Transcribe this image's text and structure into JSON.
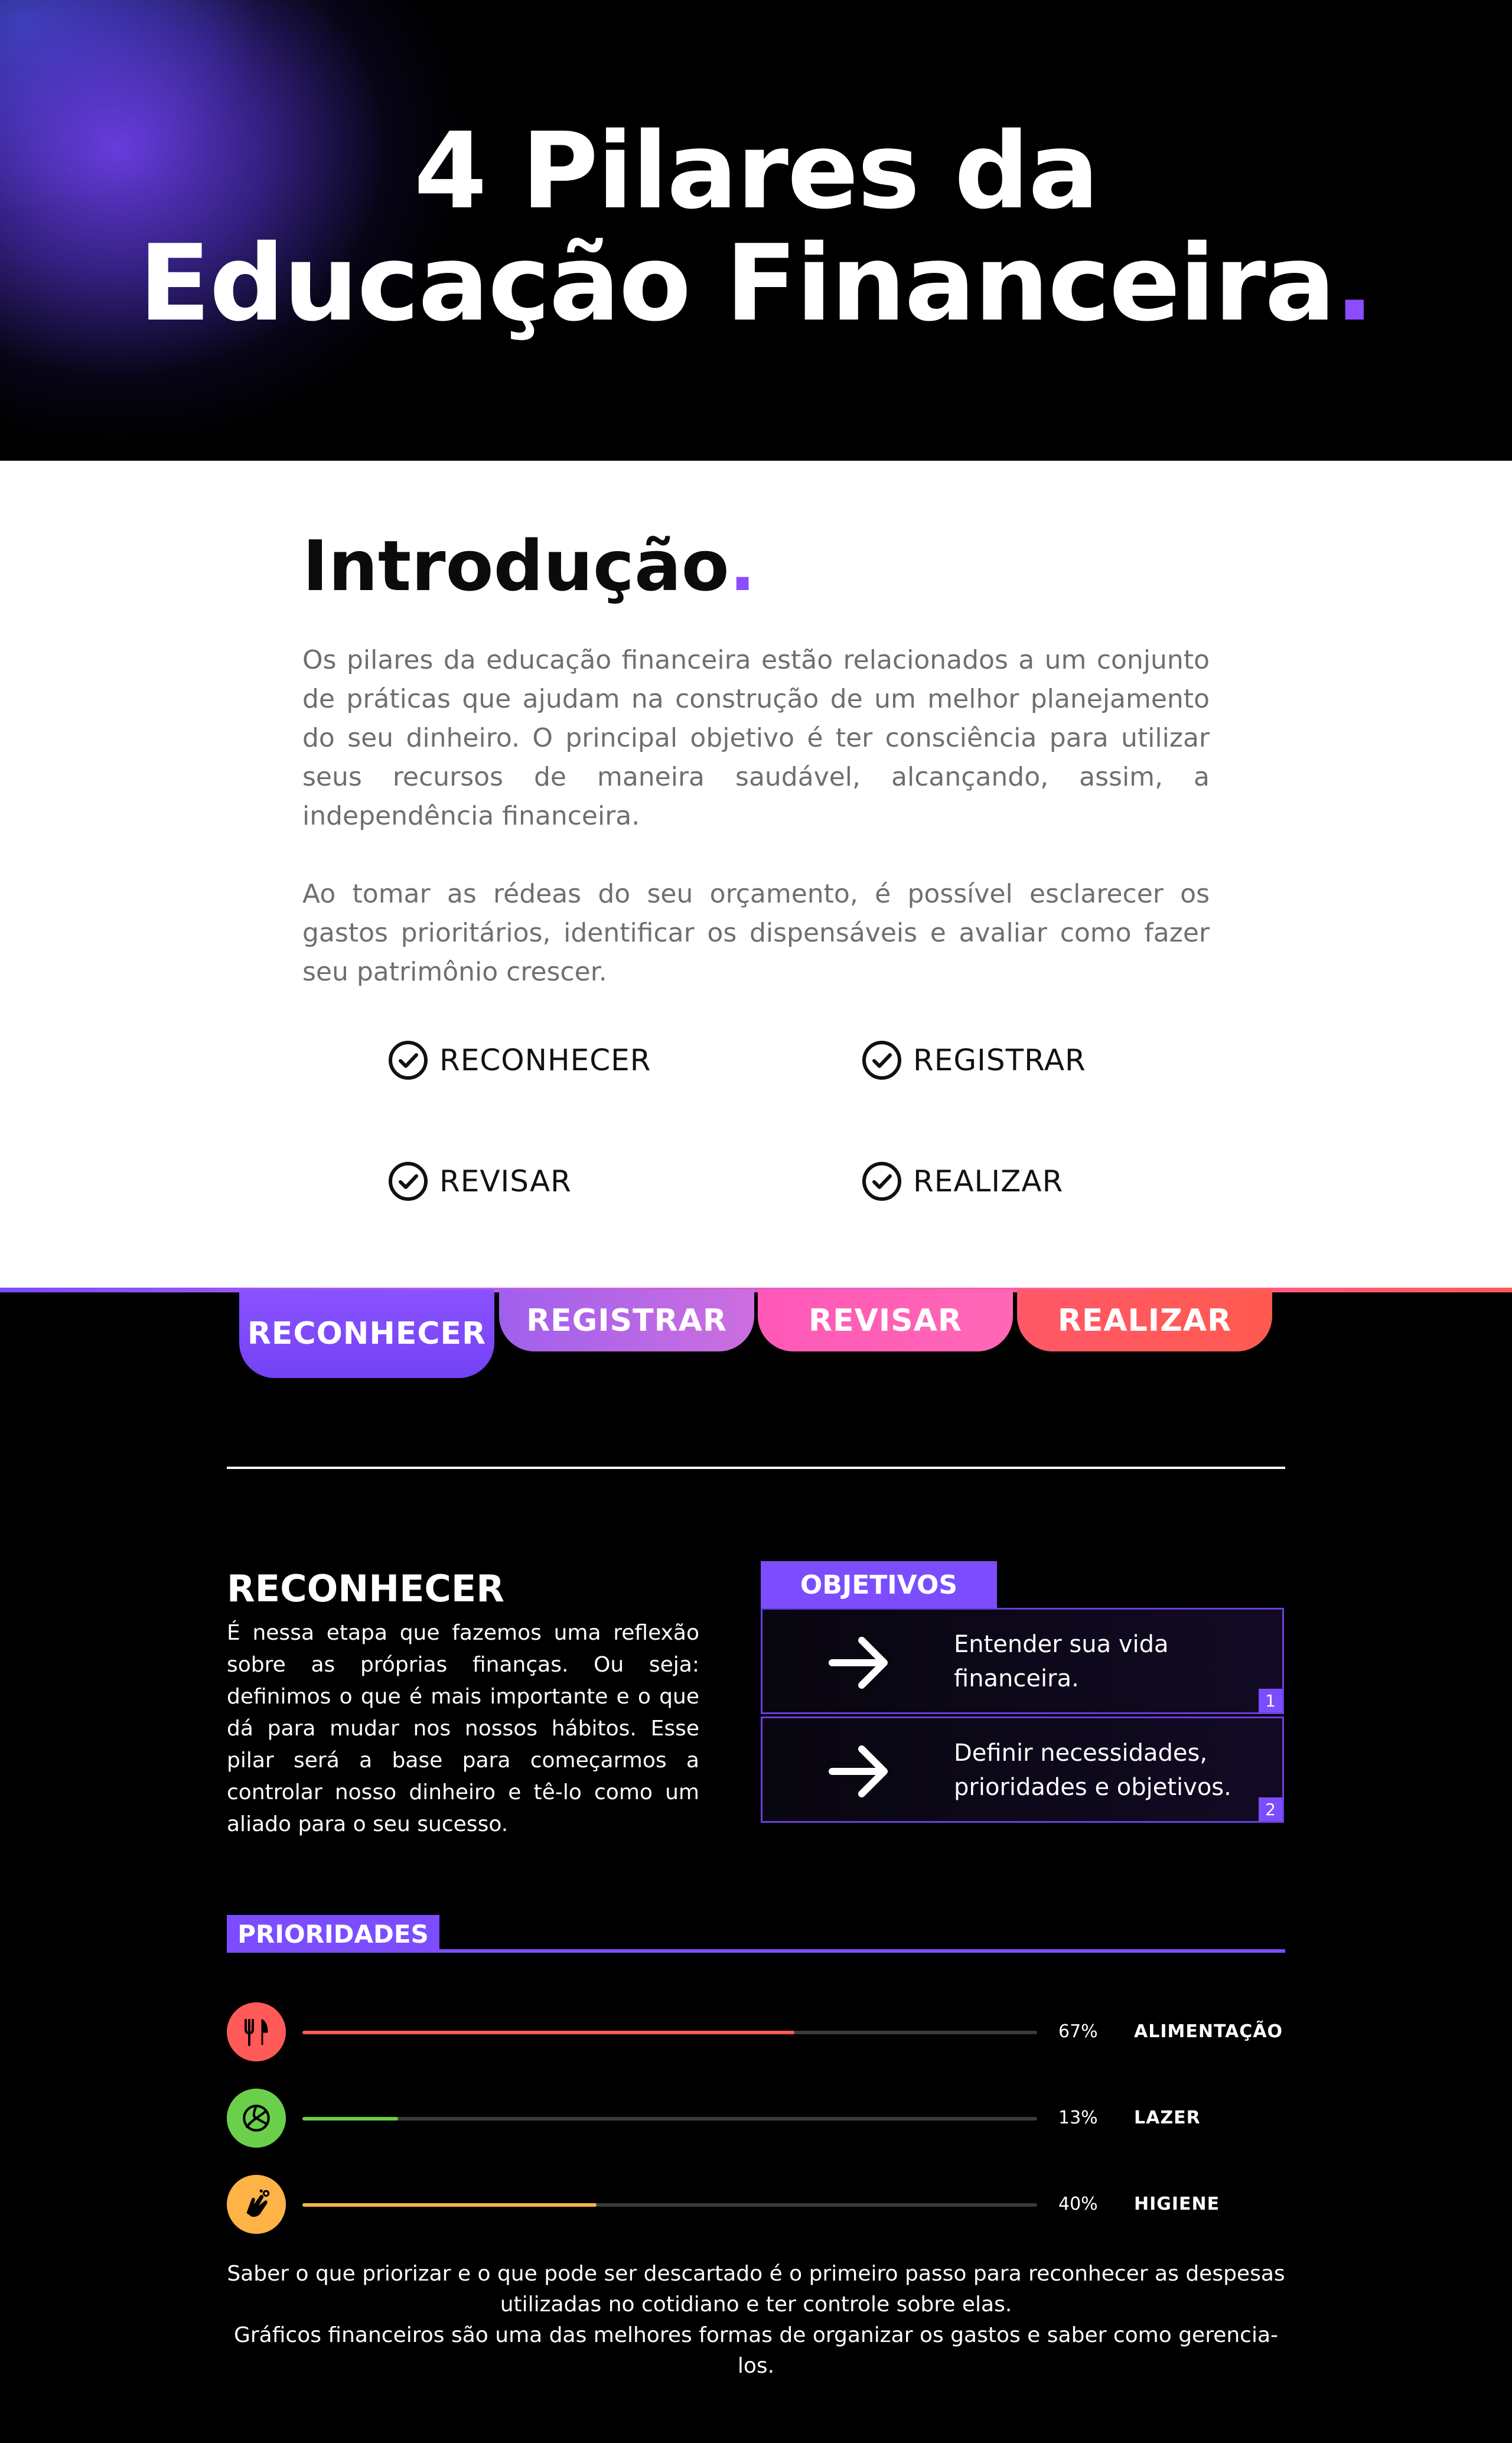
{
  "hero": {
    "title_line1": "4 Pilares da",
    "title_line2": "Educação Financeira",
    "title_dot": "."
  },
  "intro": {
    "heading": "Introdução",
    "heading_dot": ".",
    "paragraph1": "Os pilares da educação financeira estão relacionados a um conjunto de práticas que ajudam na construção de um melhor planejamento do seu dinheiro. O principal objetivo é ter consciência para utilizar seus recursos de maneira saudável, alcançando, assim, a independência financeira.",
    "paragraph2": "Ao tomar as rédeas do seu orçamento, é possível esclarecer os gastos prioritários, identificar os dispensáveis e avaliar como fazer seu patrimônio crescer.",
    "checklist": [
      "RECONHECER",
      "REGISTRAR",
      "REVISAR",
      "REALIZAR"
    ]
  },
  "tabs": [
    {
      "label": "RECONHECER",
      "color": "#7b4dff",
      "active": true
    },
    {
      "label": "REGISTRAR",
      "color": "#b768e6",
      "active": false
    },
    {
      "label": "REVISAR",
      "color": "#ff5fb3",
      "active": false
    },
    {
      "label": "REALIZAR",
      "color": "#ff5a57",
      "active": false
    }
  ],
  "section": {
    "title": "RECONHECER",
    "body": "É nessa etapa que fazemos uma reflexão sobre as próprias finanças. Ou seja: definimos o que é mais importante e o que dá para mudar nos nossos hábitos. Esse pilar será a base para começarmos a controlar nosso dinheiro e tê-lo como um aliado para o seu sucesso."
  },
  "objectives": {
    "label": "OBJETIVOS",
    "items": [
      {
        "text": "Entender sua vida financeira.",
        "number": "1",
        "icon": "arrow-right-icon"
      },
      {
        "text": "Definir necessidades, prioridades e objetivos.",
        "number": "2",
        "icon": "arrow-right-icon"
      }
    ]
  },
  "priorities": {
    "label": "PRIORIDADES",
    "items": [
      {
        "label": "ALIMENTAÇÃO",
        "percent_text": "67%",
        "percent": 67,
        "color": "#ff5a57",
        "icon": "fork-knife-icon"
      },
      {
        "label": "LAZER",
        "percent_text": "13%",
        "percent": 13,
        "color": "#6ad04b",
        "icon": "volleyball-icon"
      },
      {
        "label": "HIGIENE",
        "percent_text": "40%",
        "percent": 40,
        "color": "#ffb347",
        "icon": "washing-hands-icon"
      }
    ]
  },
  "footer": {
    "line1": "Saber o que priorizar e o que pode ser descartado é o primeiro passo para reconhecer as despesas utilizadas no cotidiano e ter controle sobre elas.",
    "line2": "Gráficos financeiros são uma das melhores formas de organizar os gastos e saber como gerencia-los."
  },
  "colors": {
    "accent_purple": "#7c4dff",
    "dot_purple": "#8b4dff",
    "background_dark": "#000000",
    "intro_background": "#ffffff"
  }
}
